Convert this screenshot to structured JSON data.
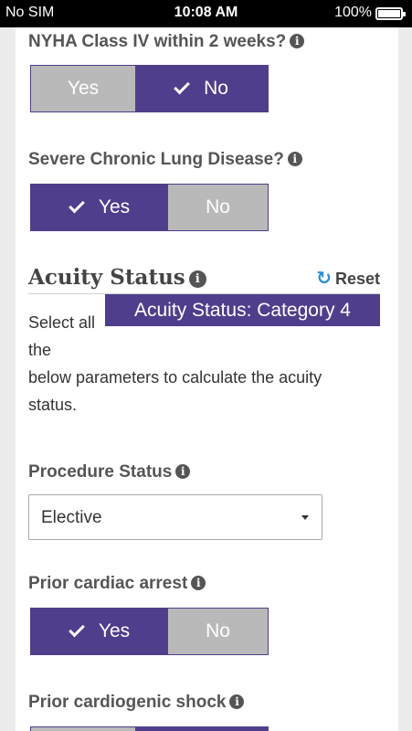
{
  "status_bar": {
    "carrier": "No SIM",
    "time": "10:08 AM",
    "battery": "100%",
    "battery_level": 1.0
  },
  "questions": {
    "nyha": {
      "label": "NYHA Class IV within 2 weeks?",
      "yes": "Yes",
      "no": "No",
      "selected": "No"
    },
    "lung": {
      "label": "Severe Chronic Lung Disease?",
      "yes": "Yes",
      "no": "No",
      "selected": "Yes"
    },
    "cardiac_arrest": {
      "label": "Prior cardiac arrest",
      "yes": "Yes",
      "no": "No",
      "selected": "Yes"
    },
    "cardiogenic_shock": {
      "label": "Prior cardiogenic shock"
    }
  },
  "acuity": {
    "title": "Acuity Status",
    "reset": "Reset",
    "badge": "Acuity Status: Category 4",
    "desc_line1": "Select all",
    "desc_line2": "the",
    "desc_line3": "below parameters to calculate the acuity",
    "desc_line4": "status."
  },
  "procedure": {
    "label": "Procedure Status",
    "value": "Elective"
  },
  "colors": {
    "accent": "#4f3e8c",
    "unselected": "#b9b9b9",
    "reset_icon": "#2d8fd6"
  }
}
